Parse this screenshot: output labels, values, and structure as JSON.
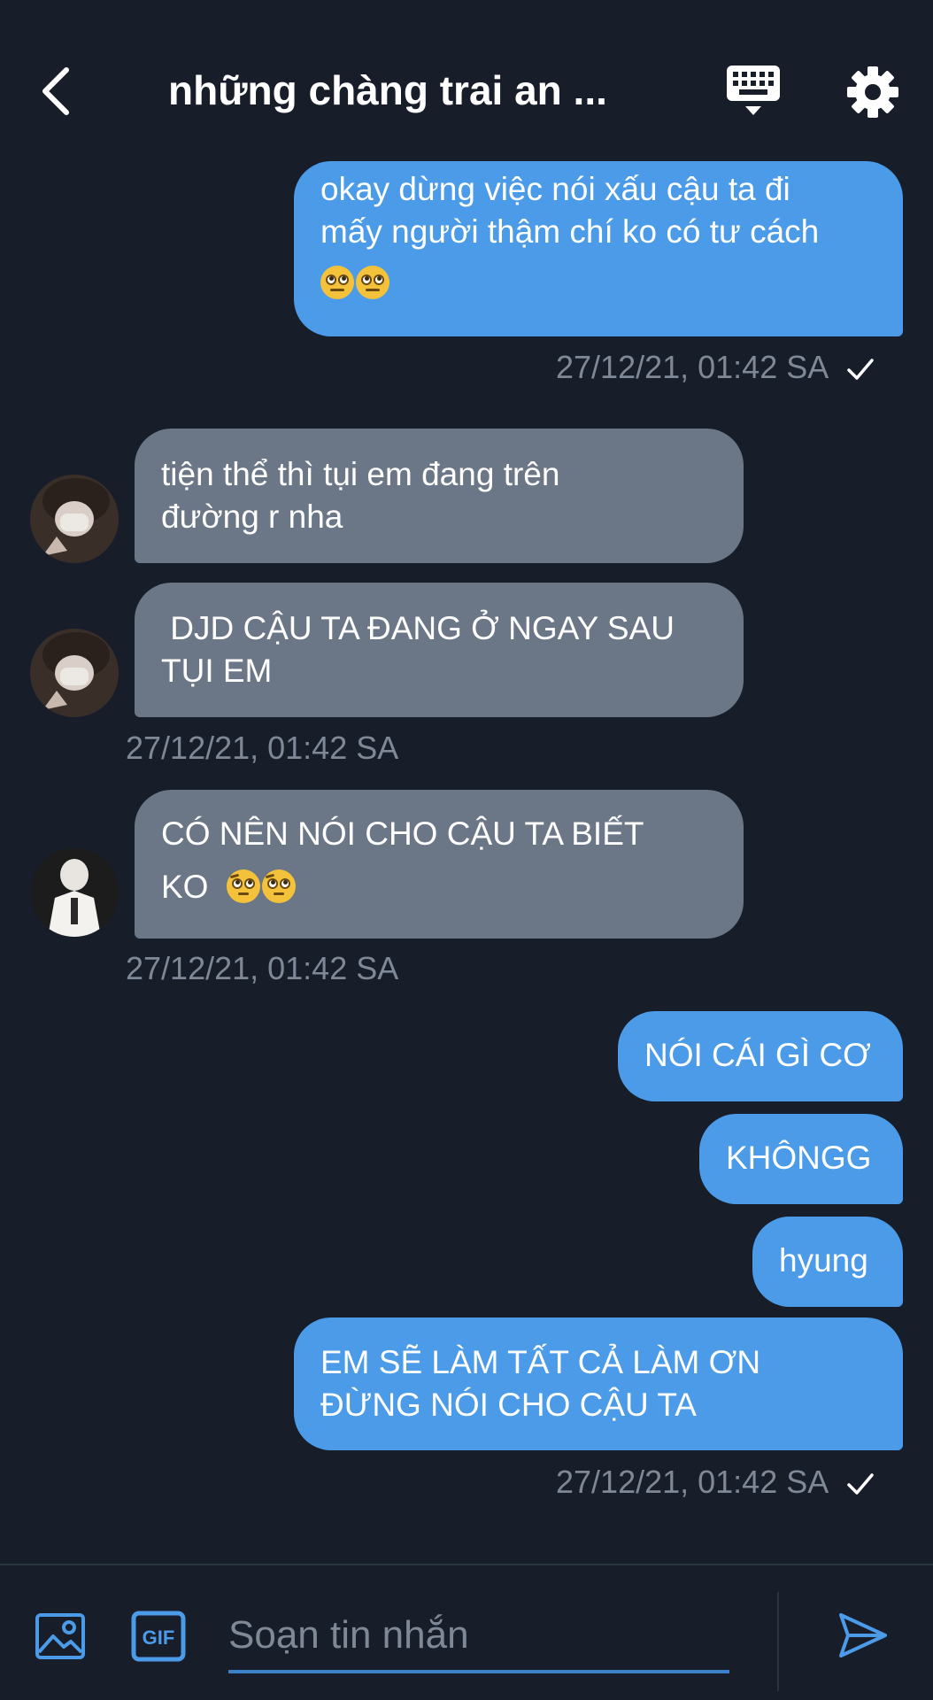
{
  "header": {
    "title": "những chàng trai an ...",
    "back_icon": "chevron-left-icon",
    "keyboard_icon": "keyboard-icon",
    "settings_icon": "gear-icon"
  },
  "messages": [
    {
      "direction": "outgoing",
      "text_lines": [
        "okay dừng việc nói xấu cậu ta đi",
        "mấy người thậm chí ko có tư cách"
      ],
      "emoji": [
        "face-with-rolling-eyes",
        "face-with-rolling-eyes"
      ],
      "timestamp": "27/12/21, 01:42 SA",
      "read": true
    },
    {
      "direction": "incoming",
      "text_lines": [
        "tiện thể thì tụi em đang trên",
        "đường r nha"
      ]
    },
    {
      "direction": "incoming",
      "text_lines": [
        " DJD CẬU TA ĐANG Ở NGAY SAU",
        "TỤI EM"
      ],
      "timestamp": "27/12/21, 01:42 SA"
    },
    {
      "direction": "incoming",
      "text_lines": [
        "CÓ NÊN NÓI CHO CẬU TA BIẾT",
        "KO"
      ],
      "emoji": [
        "face-with-raised-eyebrow",
        "face-with-raised-eyebrow"
      ],
      "timestamp": "27/12/21, 01:42 SA"
    },
    {
      "direction": "outgoing",
      "text_lines": [
        "NÓI CÁI GÌ CƠ"
      ]
    },
    {
      "direction": "outgoing",
      "text_lines": [
        "KHÔNGG"
      ]
    },
    {
      "direction": "outgoing",
      "text_lines": [
        "hyung"
      ]
    },
    {
      "direction": "outgoing",
      "text_lines": [
        "EM SẼ LÀM TẤT CẢ LÀM ƠN",
        "ĐỪNG NÓI CHO CẬU TA"
      ],
      "timestamp": "27/12/21, 01:42 SA",
      "read": true
    }
  ],
  "composer": {
    "placeholder": "Soạn tin nhắn",
    "image_icon": "image-icon",
    "gif_label": "GIF",
    "send_icon": "send-icon"
  },
  "colors": {
    "background": "#171e2a",
    "outgoing_bubble": "#4b9be8",
    "incoming_bubble": "#6b7786",
    "timestamp": "#7f8896",
    "accent": "#4b9be8"
  }
}
